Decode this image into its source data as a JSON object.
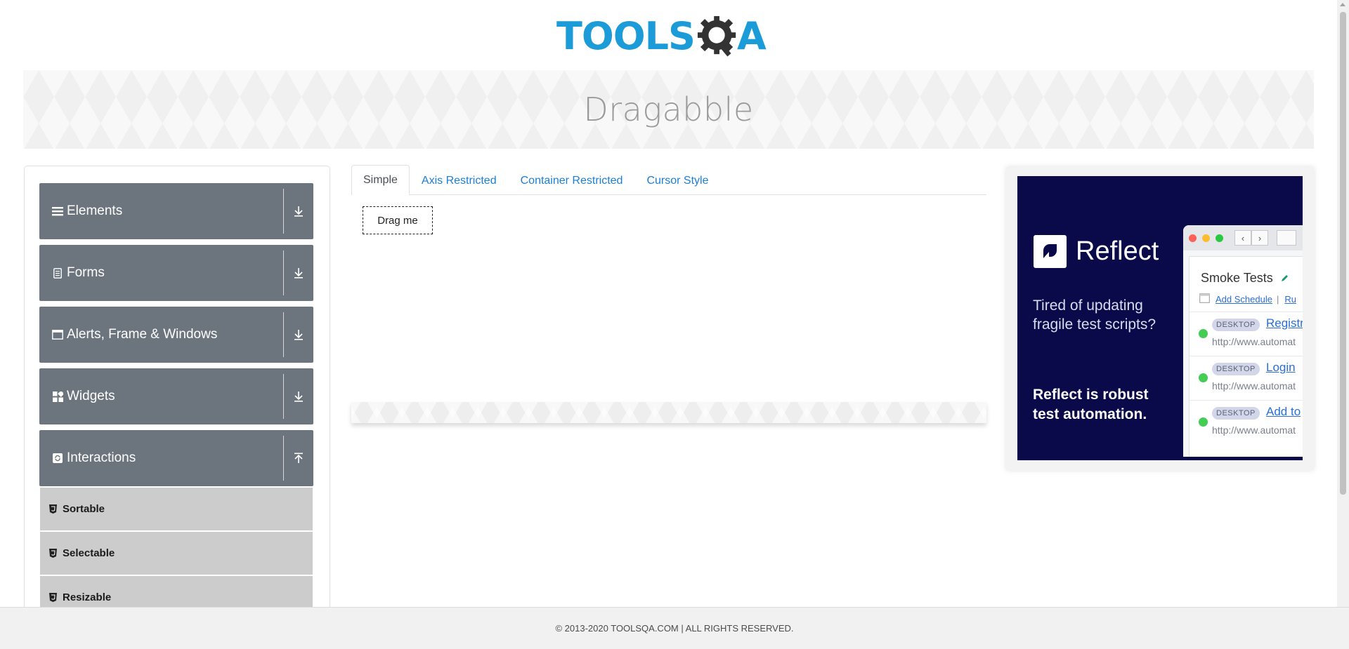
{
  "header": {
    "logo_main": "TOOLS",
    "logo_suffix": "A",
    "logo_q_icon": "gear-magnifier-icon"
  },
  "banner": {
    "title": "Dragabble"
  },
  "sidebar": {
    "groups": [
      {
        "label": "Elements",
        "icon": "menu-icon",
        "toggle_icon": "download-icon"
      },
      {
        "label": "Forms",
        "icon": "document-icon",
        "toggle_icon": "download-icon"
      },
      {
        "label": "Alerts, Frame & Windows",
        "icon": "window-icon",
        "toggle_icon": "download-icon"
      },
      {
        "label": "Widgets",
        "icon": "widgets-icon",
        "toggle_icon": "download-icon"
      },
      {
        "label": "Interactions",
        "icon": "refresh-icon",
        "toggle_icon": "upload-icon"
      }
    ],
    "items": [
      {
        "label": "Sortable",
        "icon": "html5-icon"
      },
      {
        "label": "Selectable",
        "icon": "html5-icon"
      },
      {
        "label": "Resizable",
        "icon": "html5-icon"
      }
    ]
  },
  "tabs": [
    {
      "label": "Simple",
      "active": true
    },
    {
      "label": "Axis Restricted",
      "active": false
    },
    {
      "label": "Container Restricted",
      "active": false
    },
    {
      "label": "Cursor Style",
      "active": false
    }
  ],
  "drag_box": {
    "label": "Drag me"
  },
  "ad": {
    "brand": "Reflect",
    "tagline": "Tired of updating fragile test scripts?",
    "strong": "Reflect is robust test automation.",
    "window": {
      "title": "Smoke Tests",
      "link_schedule": "Add Schedule",
      "link_separator": "|",
      "link_run": "Ru",
      "rows": [
        {
          "badge": "DESKTOP",
          "link": "Registr",
          "url": "http://www.automat"
        },
        {
          "badge": "DESKTOP",
          "link": "Login",
          "url": "http://www.automat"
        },
        {
          "badge": "DESKTOP",
          "link": "Add to",
          "url": "http://www.automat"
        }
      ],
      "nav_back": "‹",
      "nav_forward": "›"
    }
  },
  "footer": {
    "copyright": "© 2013-2020 TOOLSQA.COM | ALL RIGHTS RESERVED."
  },
  "colors": {
    "brand_blue": "#1b9bd7",
    "sidebar_group_bg": "#6c757d",
    "sidebar_item_bg": "#cccccc",
    "link_blue": "#1b7fd6",
    "ad_bg": "#0a0a4a",
    "status_green": "#44cc55"
  }
}
